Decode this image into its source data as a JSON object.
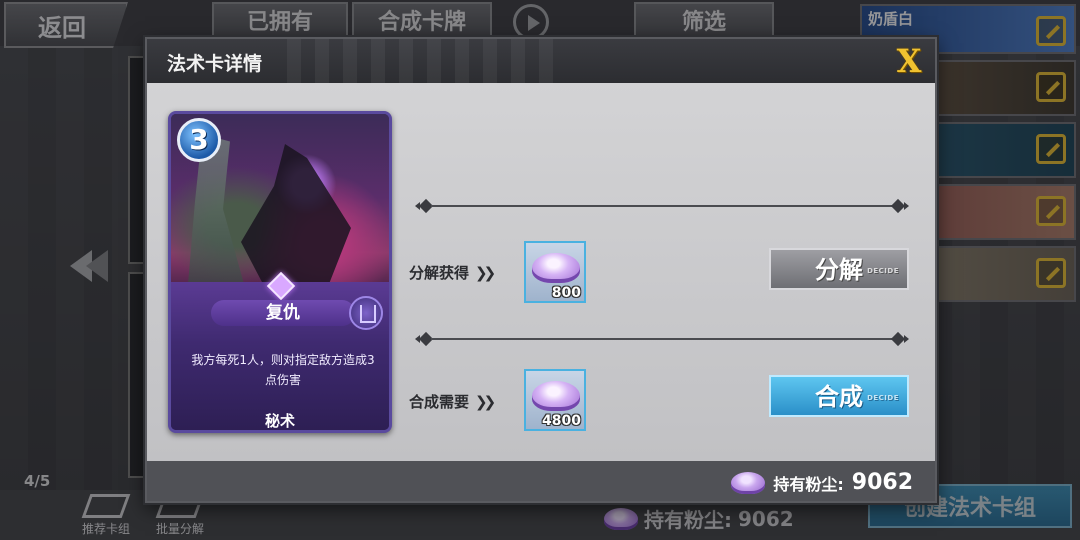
{
  "background": {
    "back_label": "返回",
    "tabs": {
      "owned": "已拥有",
      "compose": "合成卡牌",
      "filter": "筛选"
    },
    "decks": [
      {
        "name": "奶盾白"
      },
      {
        "name": ""
      },
      {
        "name": ""
      },
      {
        "name": ""
      },
      {
        "name": ""
      }
    ],
    "page_indicator": "4/5",
    "bottom": {
      "recommended_label": "推荐卡组",
      "batch_decompose_label": "批量分解",
      "dust_label": "持有粉尘:",
      "dust_value": "9062",
      "create_deck_label": "创建法术卡组"
    }
  },
  "modal": {
    "title": "法术卡详情",
    "close_label": "X",
    "card": {
      "cost": "3",
      "name": "复仇",
      "description": "我方每死1人，则对指定敌方造成3点伤害",
      "kind": "秘术"
    },
    "decompose": {
      "label": "分解获得",
      "amount": "800",
      "button_label": "分解",
      "button_tag": "DECIDE"
    },
    "compose": {
      "label": "合成需要",
      "amount": "4800",
      "button_label": "合成",
      "button_tag": "DECIDE"
    },
    "footer": {
      "dust_label": "持有粉尘:",
      "dust_value": "9062"
    }
  },
  "colors": {
    "compose_button": "#3aa6dc",
    "close_x": "#f0c230",
    "card_frame": "#5a4a9e"
  }
}
